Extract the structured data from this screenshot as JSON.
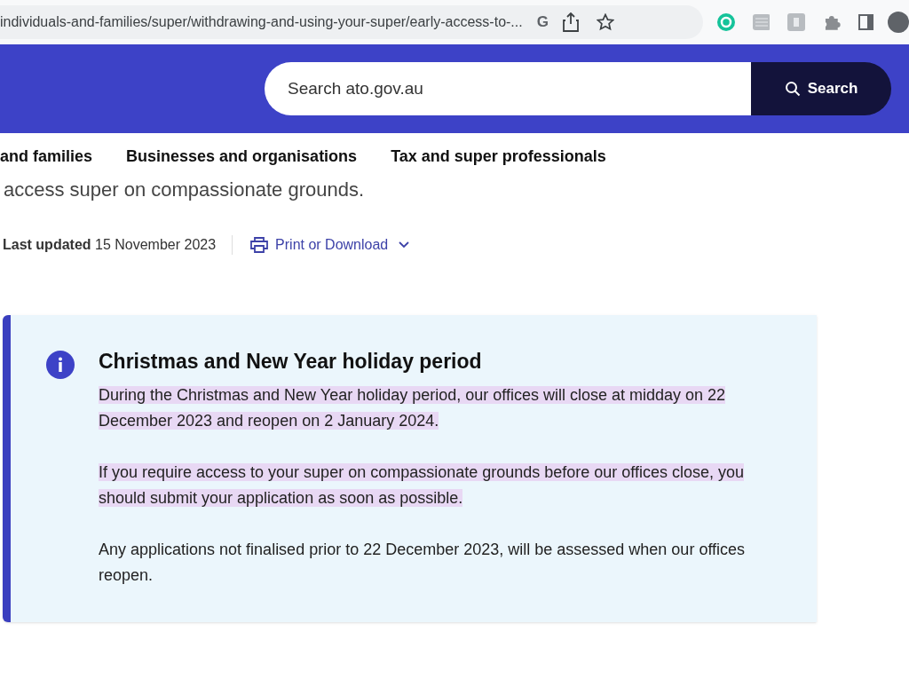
{
  "browser": {
    "url": "individuals-and-families/super/withdrawing-and-using-your-super/early-access-to-...",
    "url_icon": "G"
  },
  "header": {
    "search": {
      "placeholder": "Search ato.gov.au",
      "button": "Search"
    }
  },
  "nav": {
    "items": [
      "and families",
      "Businesses and organisations",
      "Tax and super professionals"
    ]
  },
  "subtitle": "access super on compassionate grounds.",
  "meta": {
    "label": "Last updated",
    "date": "15 November 2023",
    "print": "Print or Download"
  },
  "notice": {
    "title": "Christmas and New Year holiday period",
    "paragraphs": [
      {
        "text": "During the Christmas and New Year holiday period, our offices will close at midday on 22 December 2023 and reopen on 2 January 2024.",
        "highlighted": true
      },
      {
        "text": "If you require access to your super on compassionate grounds before our offices close, you should submit your application as soon as possible.",
        "highlighted": true
      },
      {
        "text": "Any applications not finalised prior to 22 December 2023, will be assessed when our offices reopen.",
        "highlighted": false
      }
    ]
  }
}
